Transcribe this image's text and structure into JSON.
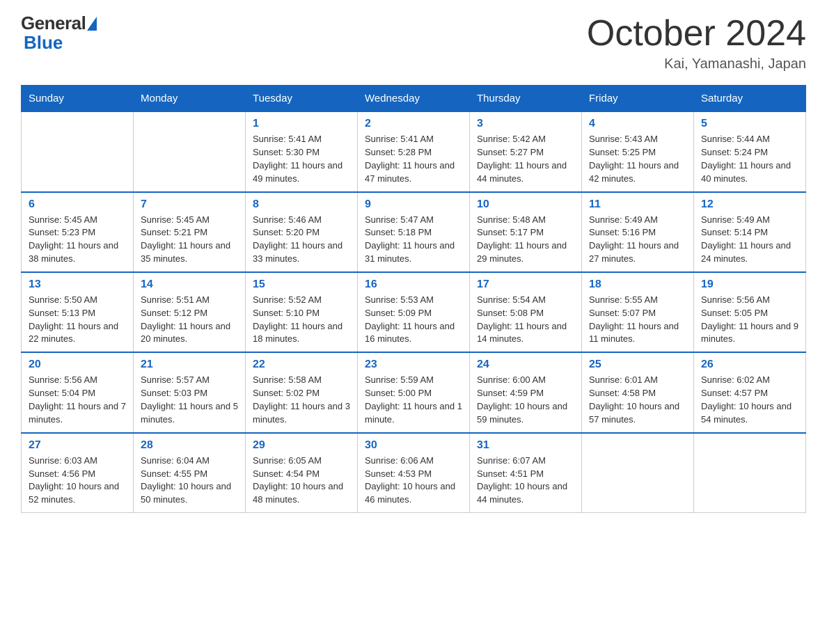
{
  "header": {
    "logo_general": "General",
    "logo_blue": "Blue",
    "title": "October 2024",
    "location": "Kai, Yamanashi, Japan"
  },
  "weekdays": [
    "Sunday",
    "Monday",
    "Tuesday",
    "Wednesday",
    "Thursday",
    "Friday",
    "Saturday"
  ],
  "weeks": [
    [
      {
        "day": "",
        "info": ""
      },
      {
        "day": "",
        "info": ""
      },
      {
        "day": "1",
        "info": "Sunrise: 5:41 AM\nSunset: 5:30 PM\nDaylight: 11 hours\nand 49 minutes."
      },
      {
        "day": "2",
        "info": "Sunrise: 5:41 AM\nSunset: 5:28 PM\nDaylight: 11 hours\nand 47 minutes."
      },
      {
        "day": "3",
        "info": "Sunrise: 5:42 AM\nSunset: 5:27 PM\nDaylight: 11 hours\nand 44 minutes."
      },
      {
        "day": "4",
        "info": "Sunrise: 5:43 AM\nSunset: 5:25 PM\nDaylight: 11 hours\nand 42 minutes."
      },
      {
        "day": "5",
        "info": "Sunrise: 5:44 AM\nSunset: 5:24 PM\nDaylight: 11 hours\nand 40 minutes."
      }
    ],
    [
      {
        "day": "6",
        "info": "Sunrise: 5:45 AM\nSunset: 5:23 PM\nDaylight: 11 hours\nand 38 minutes."
      },
      {
        "day": "7",
        "info": "Sunrise: 5:45 AM\nSunset: 5:21 PM\nDaylight: 11 hours\nand 35 minutes."
      },
      {
        "day": "8",
        "info": "Sunrise: 5:46 AM\nSunset: 5:20 PM\nDaylight: 11 hours\nand 33 minutes."
      },
      {
        "day": "9",
        "info": "Sunrise: 5:47 AM\nSunset: 5:18 PM\nDaylight: 11 hours\nand 31 minutes."
      },
      {
        "day": "10",
        "info": "Sunrise: 5:48 AM\nSunset: 5:17 PM\nDaylight: 11 hours\nand 29 minutes."
      },
      {
        "day": "11",
        "info": "Sunrise: 5:49 AM\nSunset: 5:16 PM\nDaylight: 11 hours\nand 27 minutes."
      },
      {
        "day": "12",
        "info": "Sunrise: 5:49 AM\nSunset: 5:14 PM\nDaylight: 11 hours\nand 24 minutes."
      }
    ],
    [
      {
        "day": "13",
        "info": "Sunrise: 5:50 AM\nSunset: 5:13 PM\nDaylight: 11 hours\nand 22 minutes."
      },
      {
        "day": "14",
        "info": "Sunrise: 5:51 AM\nSunset: 5:12 PM\nDaylight: 11 hours\nand 20 minutes."
      },
      {
        "day": "15",
        "info": "Sunrise: 5:52 AM\nSunset: 5:10 PM\nDaylight: 11 hours\nand 18 minutes."
      },
      {
        "day": "16",
        "info": "Sunrise: 5:53 AM\nSunset: 5:09 PM\nDaylight: 11 hours\nand 16 minutes."
      },
      {
        "day": "17",
        "info": "Sunrise: 5:54 AM\nSunset: 5:08 PM\nDaylight: 11 hours\nand 14 minutes."
      },
      {
        "day": "18",
        "info": "Sunrise: 5:55 AM\nSunset: 5:07 PM\nDaylight: 11 hours\nand 11 minutes."
      },
      {
        "day": "19",
        "info": "Sunrise: 5:56 AM\nSunset: 5:05 PM\nDaylight: 11 hours\nand 9 minutes."
      }
    ],
    [
      {
        "day": "20",
        "info": "Sunrise: 5:56 AM\nSunset: 5:04 PM\nDaylight: 11 hours\nand 7 minutes."
      },
      {
        "day": "21",
        "info": "Sunrise: 5:57 AM\nSunset: 5:03 PM\nDaylight: 11 hours\nand 5 minutes."
      },
      {
        "day": "22",
        "info": "Sunrise: 5:58 AM\nSunset: 5:02 PM\nDaylight: 11 hours\nand 3 minutes."
      },
      {
        "day": "23",
        "info": "Sunrise: 5:59 AM\nSunset: 5:00 PM\nDaylight: 11 hours\nand 1 minute."
      },
      {
        "day": "24",
        "info": "Sunrise: 6:00 AM\nSunset: 4:59 PM\nDaylight: 10 hours\nand 59 minutes."
      },
      {
        "day": "25",
        "info": "Sunrise: 6:01 AM\nSunset: 4:58 PM\nDaylight: 10 hours\nand 57 minutes."
      },
      {
        "day": "26",
        "info": "Sunrise: 6:02 AM\nSunset: 4:57 PM\nDaylight: 10 hours\nand 54 minutes."
      }
    ],
    [
      {
        "day": "27",
        "info": "Sunrise: 6:03 AM\nSunset: 4:56 PM\nDaylight: 10 hours\nand 52 minutes."
      },
      {
        "day": "28",
        "info": "Sunrise: 6:04 AM\nSunset: 4:55 PM\nDaylight: 10 hours\nand 50 minutes."
      },
      {
        "day": "29",
        "info": "Sunrise: 6:05 AM\nSunset: 4:54 PM\nDaylight: 10 hours\nand 48 minutes."
      },
      {
        "day": "30",
        "info": "Sunrise: 6:06 AM\nSunset: 4:53 PM\nDaylight: 10 hours\nand 46 minutes."
      },
      {
        "day": "31",
        "info": "Sunrise: 6:07 AM\nSunset: 4:51 PM\nDaylight: 10 hours\nand 44 minutes."
      },
      {
        "day": "",
        "info": ""
      },
      {
        "day": "",
        "info": ""
      }
    ]
  ]
}
